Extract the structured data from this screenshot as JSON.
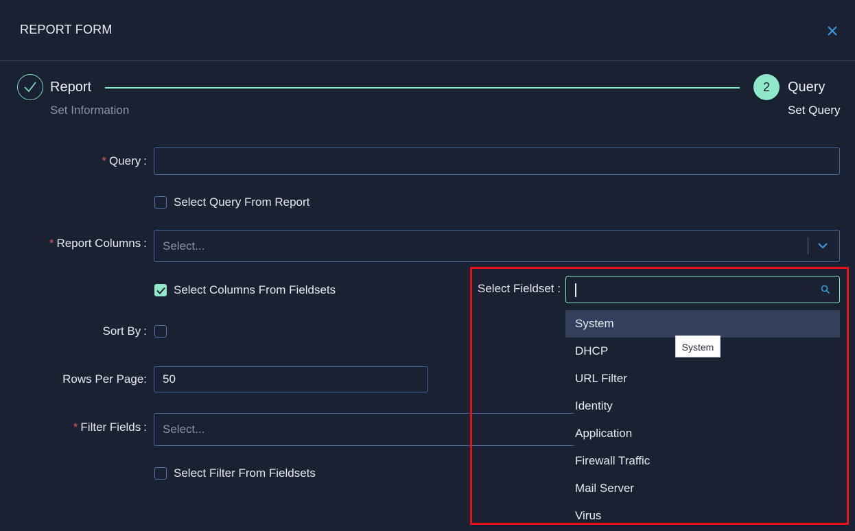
{
  "modal": {
    "title": "REPORT FORM",
    "close_icon": "close-icon"
  },
  "stepper": {
    "steps": [
      {
        "label": "Report",
        "sub": "Set Information",
        "status": "done",
        "icon": "check-icon"
      },
      {
        "label": "Query",
        "sub": "Set Query",
        "status": "active",
        "number": "2"
      }
    ]
  },
  "form": {
    "query": {
      "label": "Query",
      "value": ""
    },
    "select_query_checkbox": {
      "label": "Select Query From Report",
      "checked": false
    },
    "report_columns": {
      "label": "Report Columns",
      "placeholder": "Select..."
    },
    "select_columns_checkbox": {
      "label": "Select Columns From Fieldsets",
      "checked": true
    },
    "sort_by": {
      "label": "Sort By",
      "checked": false
    },
    "rows_per_page": {
      "label": "Rows Per Page:",
      "value": "50"
    },
    "filter_fields": {
      "label": "Filter Fields",
      "placeholder": "Select..."
    },
    "select_filter_checkbox": {
      "label": "Select Filter From Fieldsets",
      "checked": false
    },
    "colon": ":"
  },
  "fieldset": {
    "label": "Select Fieldset :",
    "search_value": "",
    "options": [
      "System",
      "DHCP",
      "URL Filter",
      "Identity",
      "Application",
      "Firewall Traffic",
      "Mail Server",
      "Virus"
    ],
    "hovered": "System",
    "tooltip": "System"
  },
  "colors": {
    "background": "#1a2133",
    "accent": "#8ee8c9",
    "border": "#4b6aa5",
    "required": "#e0565b",
    "highlight": "#e3121b"
  }
}
